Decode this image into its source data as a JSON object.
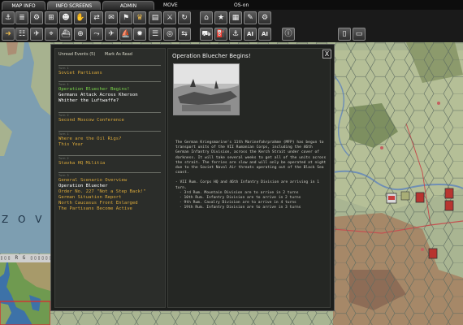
{
  "tabs": [
    {
      "label": "MAP INFO",
      "active": false
    },
    {
      "label": "INFO SCREENS",
      "active": true
    },
    {
      "label": "ADMIN",
      "active": false
    }
  ],
  "top_labels": {
    "mode": "MOVE",
    "os": "OS-on"
  },
  "toolbar1_icons": [
    "anchor-icon",
    "unit-list-icon",
    "gear-icon",
    "grid-icon",
    "people-icon",
    "hands-icon",
    "supply-icon",
    "mail-icon",
    "flag-icon",
    "star-icon",
    "document-icon",
    "sword-icon",
    "refresh-icon"
  ],
  "toolbar2_icons": [
    "arrow-icon",
    "rail-icon",
    "air-icon",
    "aa-icon",
    "naval-icon",
    "reinforce-icon",
    "path-icon",
    "plane-icon",
    "ship-icon",
    "bomb-icon",
    "mission-icon",
    "recon-icon",
    "transport-icon",
    "supply-run-icon",
    "fuel-icon",
    "harbor-icon",
    "airbase-icon",
    "ai-icon",
    "ai-icon",
    "info-icon",
    "map-icon"
  ],
  "toolbar2_ai_label": "AI",
  "minimap": {
    "sea_label": "Z O V",
    "coord_text": "▯▯▯ R G ▯▯▯▯▯▯"
  },
  "dialog": {
    "list_header": {
      "unread": "Unread Events (5)",
      "mark_all": "Mark As Read"
    },
    "groups": [
      {
        "turn": "Turn 1",
        "items": [
          {
            "text": "Soviet Partisans",
            "style": "normal"
          }
        ]
      },
      {
        "turn": "Turn 1",
        "items": [
          {
            "text": "Operation Bluecher Begins!",
            "style": "green"
          },
          {
            "text": "Germans Attack Across Kherson",
            "style": "sel"
          },
          {
            "text": "Whither the Luftwaffe?",
            "style": "sel"
          }
        ]
      },
      {
        "turn": "Turn 2",
        "items": [
          {
            "text": "Second Moscow Conference",
            "style": "normal"
          }
        ]
      },
      {
        "turn": "Turn 1",
        "items": [
          {
            "text": "Where are the Oil Rigs?",
            "style": "normal"
          },
          {
            "text": "This Year",
            "style": "normal"
          }
        ]
      },
      {
        "turn": "Turn 2",
        "items": [
          {
            "text": "Stavka HQ Militia",
            "style": "normal"
          }
        ]
      },
      {
        "turn": "Turn 3",
        "items": [
          {
            "text": "General Scenario Overview",
            "style": "normal"
          },
          {
            "text": "Operation Bluecher",
            "style": "sel"
          },
          {
            "text": "Order No. 227 \"Not a Step Back!\"",
            "style": "normal"
          },
          {
            "text": "German Situation Report",
            "style": "normal"
          },
          {
            "text": "North Caucasus Front Enlarged",
            "style": "normal"
          },
          {
            "text": "The Partisans Become Active",
            "style": "normal"
          }
        ]
      }
    ],
    "detail": {
      "title": "Operation Bluecher Begins!",
      "close_label": "X",
      "paragraph": "The German Kriegsmarine's 11th Marinefahrprahme (MFP) has begun to transport units of the VII Rumanian Corps, including the 46th German Infantry Division, across the Kerch Strait under cover of darkness. It will take several weeks to get all of the units across the strait. The ferries are slow and will only be operated at night due to the Soviet Naval Air threats operating out of the Black Sea coast.",
      "bullet_intro": "- VII Rum. Corps HQ and 46th Infantry Division are arriving in 1 turn.",
      "bullets": [
        "- 3rd Rum. Mountain Division are to arrive in 2 turns",
        "- 10th Rum. Infantry Division are to arrive in 2 turns",
        "- 9th Rum. Cavalry Division are to arrive in 4 turns",
        "- 19th Rum. Infantry Division are to arrive in 3 turns"
      ]
    }
  }
}
